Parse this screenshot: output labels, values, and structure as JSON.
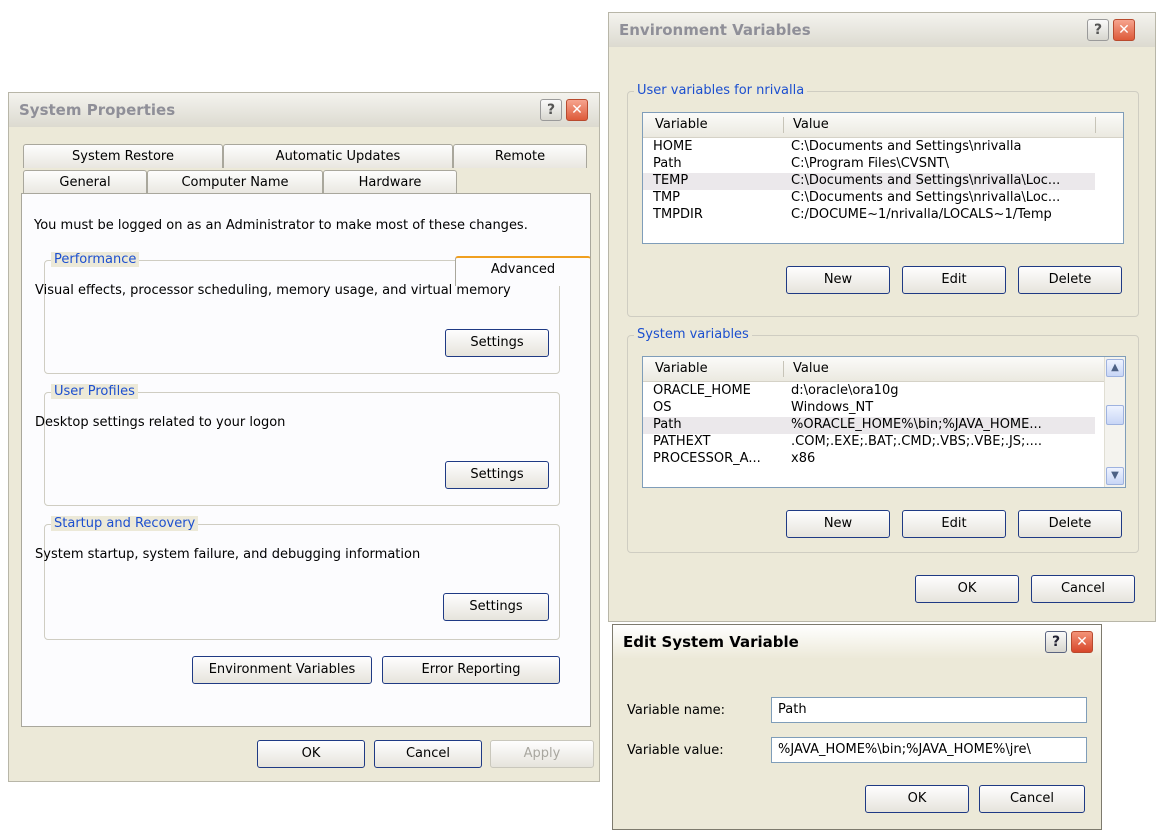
{
  "sysprops": {
    "title": "System Properties",
    "tabs_row1": [
      "System Restore",
      "Automatic Updates",
      "Remote"
    ],
    "tabs_row2": [
      "General",
      "Computer Name",
      "Hardware",
      "Advanced"
    ],
    "intro": "You must be logged on as an Administrator to make most of these changes.",
    "performance": {
      "legend": "Performance",
      "desc": "Visual effects, processor scheduling, memory usage, and virtual memory",
      "button": "Settings"
    },
    "user_profiles": {
      "legend": "User Profiles",
      "desc": "Desktop settings related to your logon",
      "button": "Settings"
    },
    "startup": {
      "legend": "Startup and Recovery",
      "desc": "System startup, system failure, and debugging information",
      "button": "Settings"
    },
    "env_button": "Environment Variables",
    "error_button": "Error Reporting",
    "ok": "OK",
    "cancel": "Cancel",
    "apply": "Apply"
  },
  "envvars": {
    "title": "Environment Variables",
    "user_group": "User variables for nrivalla",
    "user_headers": [
      "Variable",
      "Value"
    ],
    "user_rows": [
      {
        "name": "HOME",
        "value": "C:\\Documents and Settings\\nrivalla"
      },
      {
        "name": "Path",
        "value": "C:\\Program Files\\CVSNT\\"
      },
      {
        "name": "TEMP",
        "value": "C:\\Documents and Settings\\nrivalla\\Loc..."
      },
      {
        "name": "TMP",
        "value": "C:\\Documents and Settings\\nrivalla\\Loc..."
      },
      {
        "name": "TMPDIR",
        "value": "C:/DOCUME~1/nrivalla/LOCALS~1/Temp"
      }
    ],
    "user_selected": "TEMP",
    "system_group": "System variables",
    "system_headers": [
      "Variable",
      "Value"
    ],
    "system_rows": [
      {
        "name": "ORACLE_HOME",
        "value": "d:\\oracle\\ora10g"
      },
      {
        "name": "OS",
        "value": "Windows_NT"
      },
      {
        "name": "Path",
        "value": "%ORACLE_HOME%\\bin;%JAVA_HOME..."
      },
      {
        "name": "PATHEXT",
        "value": ".COM;.EXE;.BAT;.CMD;.VBS;.VBE;.JS;...."
      },
      {
        "name": "PROCESSOR_A...",
        "value": "x86"
      }
    ],
    "system_selected": "Path",
    "new": "New",
    "edit": "Edit",
    "delete": "Delete",
    "ok": "OK",
    "cancel": "Cancel"
  },
  "editvar": {
    "title": "Edit System Variable",
    "name_label": "Variable name:",
    "name_value": "Path",
    "value_label": "Variable value:",
    "value_value": "%JAVA_HOME%\\bin;%JAVA_HOME%\\jre\\",
    "ok": "OK",
    "cancel": "Cancel"
  }
}
